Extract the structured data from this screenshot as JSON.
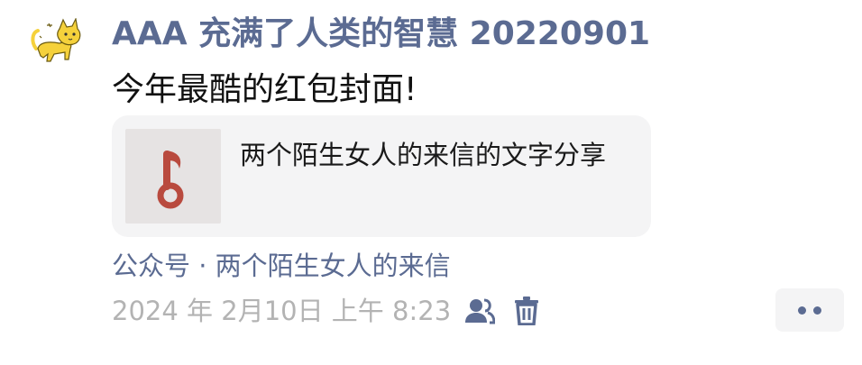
{
  "post": {
    "author": "AAA 充满了人类的智慧 20220901",
    "text": "今年最酷的红包封面!",
    "card": {
      "title": "两个陌生女人的来信的文字分享",
      "thumb_icon": "music-note-icon"
    },
    "source": "公众号 · 两个陌生女人的来信",
    "timestamp": "2024 年 2月10日 上午 8:23",
    "visibility_icon": "friends-icon",
    "delete_icon": "trash-icon",
    "more_icon": "more-dots-icon"
  },
  "colors": {
    "link": "#5b6b92",
    "meta": "#b3b3b3",
    "card_bg": "#f4f4f5",
    "thumb_bg": "#e6e3e3",
    "thumb_icon": "#b94a3e",
    "avatar_cat": "#f5d13b"
  }
}
